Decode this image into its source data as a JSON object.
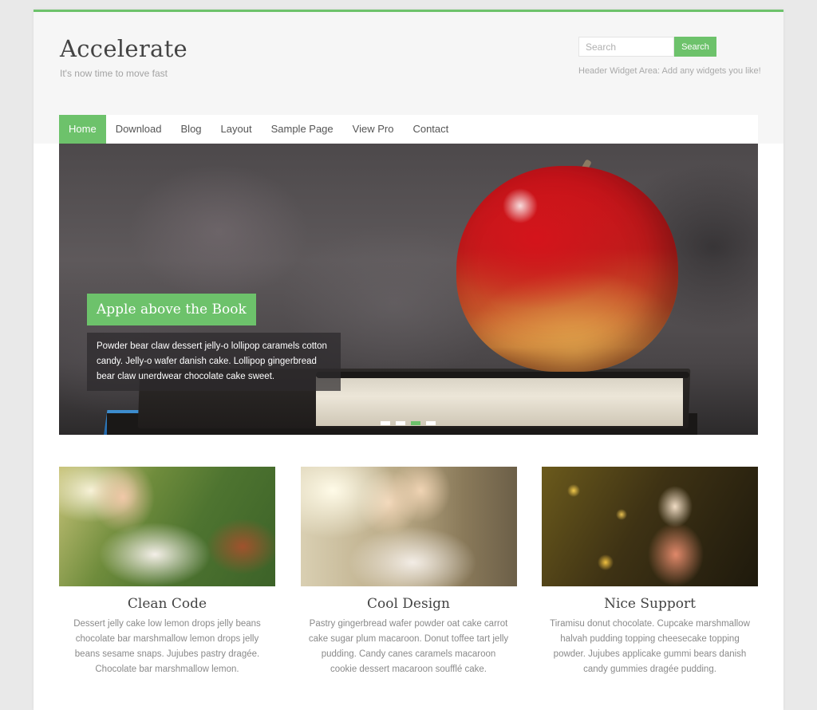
{
  "site": {
    "title": "Accelerate",
    "tagline": "It's now time to move fast",
    "accent_color": "#6dc26b"
  },
  "header_widget": {
    "search_placeholder": "Search",
    "search_button_label": "Search",
    "widget_text": "Header Widget Area: Add any widgets you like!"
  },
  "nav": {
    "items": [
      {
        "label": "Home",
        "active": true
      },
      {
        "label": "Download",
        "active": false
      },
      {
        "label": "Blog",
        "active": false
      },
      {
        "label": "Layout",
        "active": false
      },
      {
        "label": "Sample Page",
        "active": false
      },
      {
        "label": "View Pro",
        "active": false
      },
      {
        "label": "Contact",
        "active": false
      }
    ]
  },
  "slider": {
    "image_description": "Red apple sitting on a stack of books",
    "title": "Apple above the Book",
    "description": "Powder bear claw dessert jelly-o lollipop caramels cotton candy. Jelly-o wafer danish cake. Lollipop gingerbread bear claw unerdwear chocolate cake sweet.",
    "slide_count": 4,
    "active_slide": 3
  },
  "features": [
    {
      "title": "Clean Code",
      "image_description": "Smiling woman sitting in a sunny field",
      "description": "Dessert jelly cake low lemon drops jelly beans chocolate bar marshmallow lemon drops jelly beans sesame snaps. Jujubes pastry dragée. Chocolate bar marshmallow lemon."
    },
    {
      "title": "Cool Design",
      "image_description": "Two women laughing together outdoors",
      "description": "Pastry gingerbread wafer powder oat cake carrot cake sugar plum macaroon. Donut toffee tart jelly pudding. Candy canes caramels macaroon cookie dessert macaroon soufflé cake."
    },
    {
      "title": "Nice Support",
      "image_description": "Young girl looking up among glowing leaves",
      "description": "Tiramisu donut chocolate. Cupcake marshmallow halvah pudding topping cheesecake topping powder. Jujubes applicake gummi bears danish candy gummies dragée pudding."
    }
  ]
}
